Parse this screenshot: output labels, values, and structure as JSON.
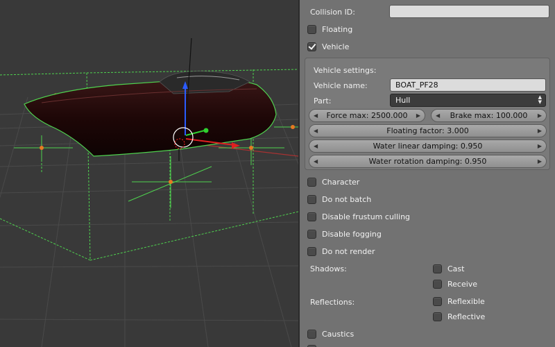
{
  "properties": {
    "collision_id_label": "Collision ID:",
    "collision_id_value": "",
    "floating_label": "Floating",
    "vehicle_label": "Vehicle",
    "vehicle_settings": {
      "title": "Vehicle settings:",
      "vehicle_name_label": "Vehicle name:",
      "vehicle_name_value": "BOAT_PF28",
      "part_label": "Part:",
      "part_value": "Hull",
      "force_max": "Force max: 2500.000",
      "brake_max": "Brake max: 100.000",
      "floating_factor": "Floating factor: 3.000",
      "water_linear_damping": "Water linear damping: 0.950",
      "water_rotation_damping": "Water rotation damping: 0.950"
    },
    "character_label": "Character",
    "do_not_batch_label": "Do not batch",
    "disable_frustum_culling_label": "Disable frustum culling",
    "disable_fogging_label": "Disable fogging",
    "do_not_render_label": "Do not render",
    "shadows_label": "Shadows:",
    "cast_label": "Cast",
    "receive_label": "Receive",
    "reflections_label": "Reflections:",
    "reflexible_label": "Reflexible",
    "reflective_label": "Reflective",
    "caustics_label": "Caustics"
  },
  "state": {
    "floating_checked": false,
    "vehicle_checked": true
  },
  "colors": {
    "viewport_bg": "#393939",
    "panel_bg": "#727272",
    "selection_outline": "#55e055",
    "hull": "#2a0c0c"
  }
}
